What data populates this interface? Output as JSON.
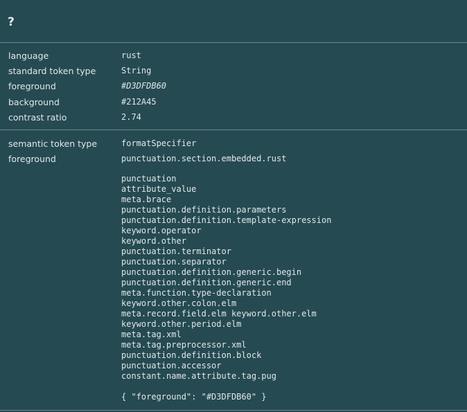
{
  "header": {
    "title": "?"
  },
  "token_info": {
    "language": {
      "label": "language",
      "value": "rust"
    },
    "standard_token_type": {
      "label": "standard token type",
      "value": "String"
    },
    "foreground": {
      "label": "foreground",
      "value": "#D3DFDB60"
    },
    "background": {
      "label": "background",
      "value": "#212A45"
    },
    "contrast_ratio": {
      "label": "contrast ratio",
      "value": "2.74"
    }
  },
  "semantic": {
    "semantic_token_type": {
      "label": "semantic token type",
      "value": "formatSpecifier"
    },
    "foreground": {
      "label": "foreground",
      "value": "punctuation.section.embedded.rust"
    },
    "scopes": [
      "punctuation",
      "attribute_value",
      "meta.brace",
      "punctuation.definition.parameters",
      "punctuation.definition.template-expression",
      "keyword.operator",
      "keyword.other",
      "punctuation.terminator",
      "punctuation.separator",
      "punctuation.definition.generic.begin",
      "punctuation.definition.generic.end",
      "meta.function.type-declaration",
      "keyword.other.colon.elm",
      "meta.record.field.elm keyword.other.elm",
      "keyword.other.period.elm",
      "meta.tag.xml",
      "meta.tag.preprocessor.xml",
      "punctuation.definition.block",
      "punctuation.accessor",
      "constant.name.attribute.tag.pug"
    ],
    "json": "{ \"foreground\": \"#D3DFDB60\" }"
  },
  "colors": {
    "panel_bg": "#264a52",
    "divider": "#6f8a8d",
    "text": "#e0e8e8"
  }
}
